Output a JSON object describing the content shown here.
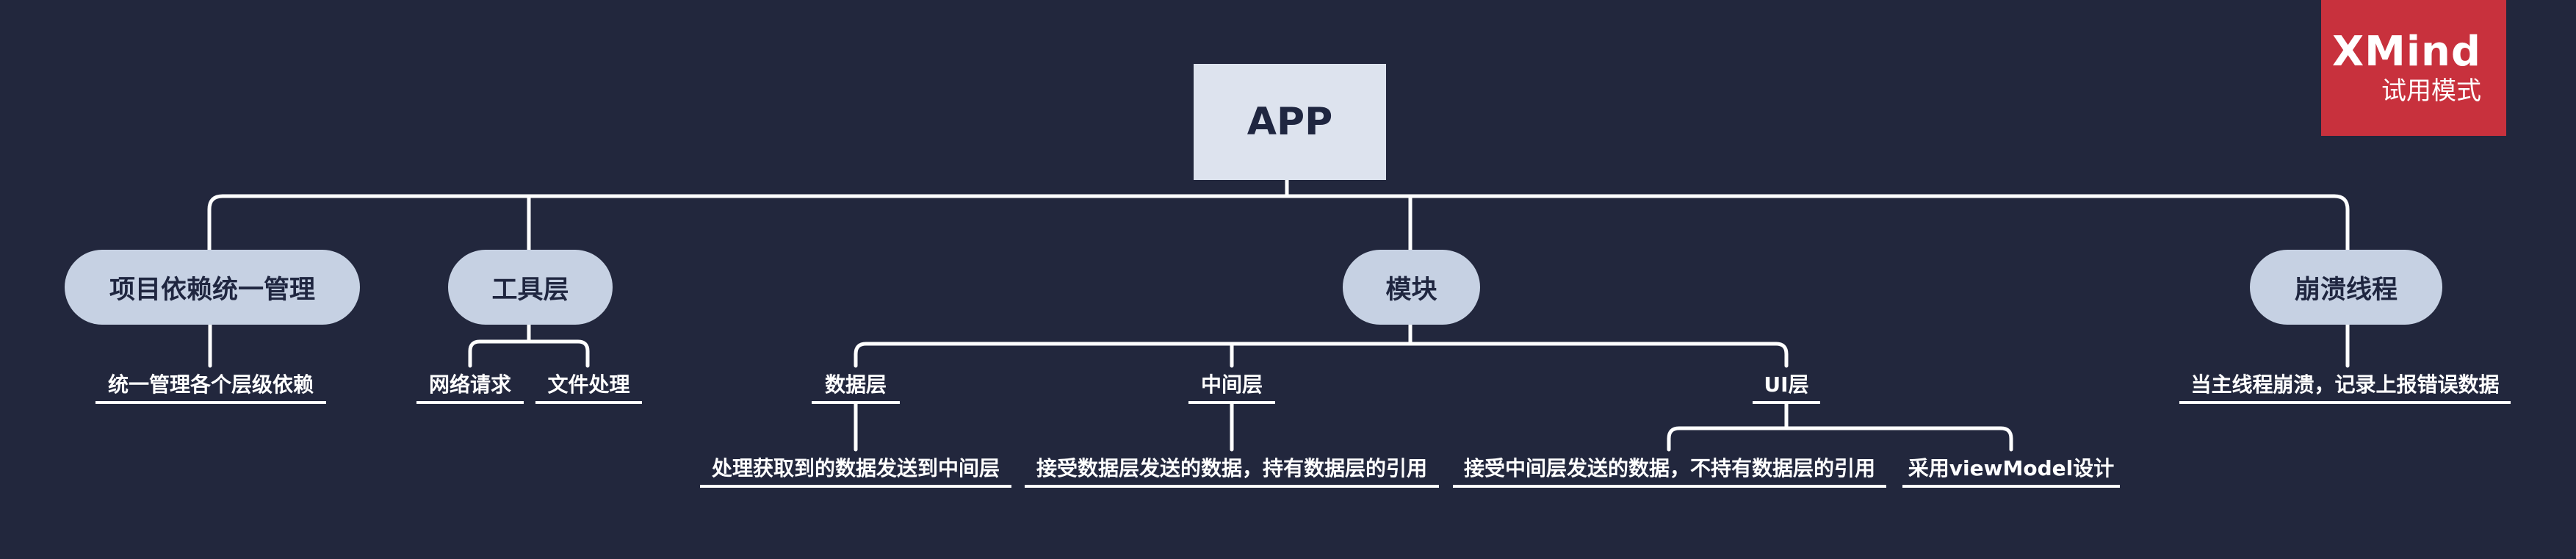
{
  "root": {
    "label": "APP"
  },
  "branches": [
    {
      "label": "项目依赖统一管理",
      "children": [
        {
          "label": "统一管理各个层级依赖"
        }
      ]
    },
    {
      "label": "工具层",
      "children": [
        {
          "label": "网络请求"
        },
        {
          "label": "文件处理"
        }
      ]
    },
    {
      "label": "模块",
      "children": [
        {
          "label": "数据层",
          "children": [
            {
              "label": "处理获取到的数据发送到中间层"
            }
          ]
        },
        {
          "label": "中间层",
          "children": [
            {
              "label": "接受数据层发送的数据，持有数据层的引用"
            }
          ]
        },
        {
          "label": "UI层",
          "children": [
            {
              "label": "接受中间层发送的数据，不持有数据层的引用"
            },
            {
              "label": "采用viewModel设计"
            }
          ]
        }
      ]
    },
    {
      "label": "崩溃线程",
      "children": [
        {
          "label": "当主线程崩溃，记录上报错误数据"
        }
      ]
    }
  ],
  "watermark": {
    "logo": "XMind",
    "subtitle": "试用模式"
  },
  "colors": {
    "background": "#22273d",
    "root_fill": "#dde3ee",
    "branch_fill": "#c6d1e3",
    "line": "#ffffff",
    "watermark": "#c8313d"
  }
}
